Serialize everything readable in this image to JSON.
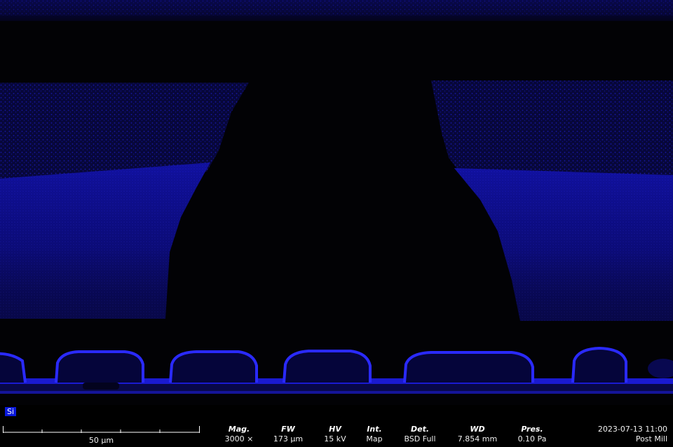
{
  "micrograph": {
    "element_label": "Si",
    "map_color": "#1414d8"
  },
  "databar": {
    "scale_bar_label": "50 µm",
    "fields": [
      {
        "label": "Mag.",
        "value": "3000 ×"
      },
      {
        "label": "FW",
        "value": "173 µm"
      },
      {
        "label": "HV",
        "value": "15 kV"
      },
      {
        "label": "Int.",
        "value": "Map"
      },
      {
        "label": "Det.",
        "value": "BSD Full"
      },
      {
        "label": "WD",
        "value": "7.854 mm"
      },
      {
        "label": "Pres.",
        "value": "0.10 Pa"
      }
    ],
    "timestamp": "2023-07-13 11:00",
    "note": "Post Mill"
  }
}
